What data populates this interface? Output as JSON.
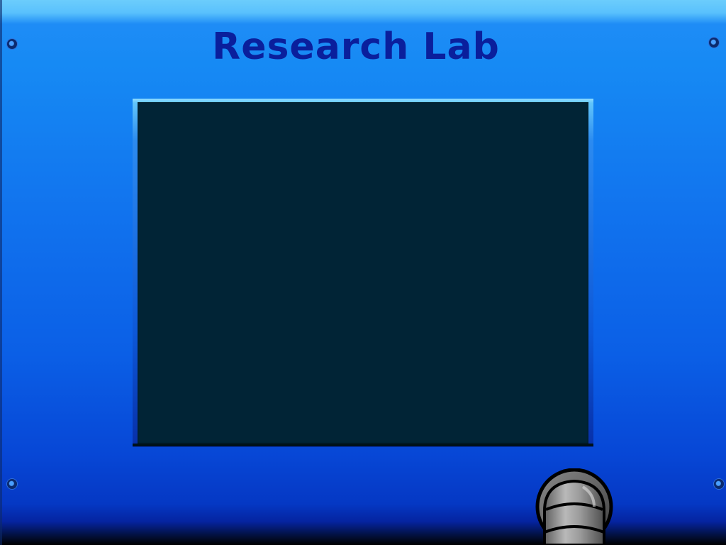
{
  "header": {
    "title": "Research Lab"
  },
  "colors": {
    "title": "#0a1f9c",
    "screen": "#012436",
    "panel_top": "#6ccdfc",
    "panel_mid": "#1173ee",
    "panel_bottom": "#0538c4"
  },
  "icons": {
    "rivets": "rivet-icon",
    "pipe": "pipe-icon"
  }
}
